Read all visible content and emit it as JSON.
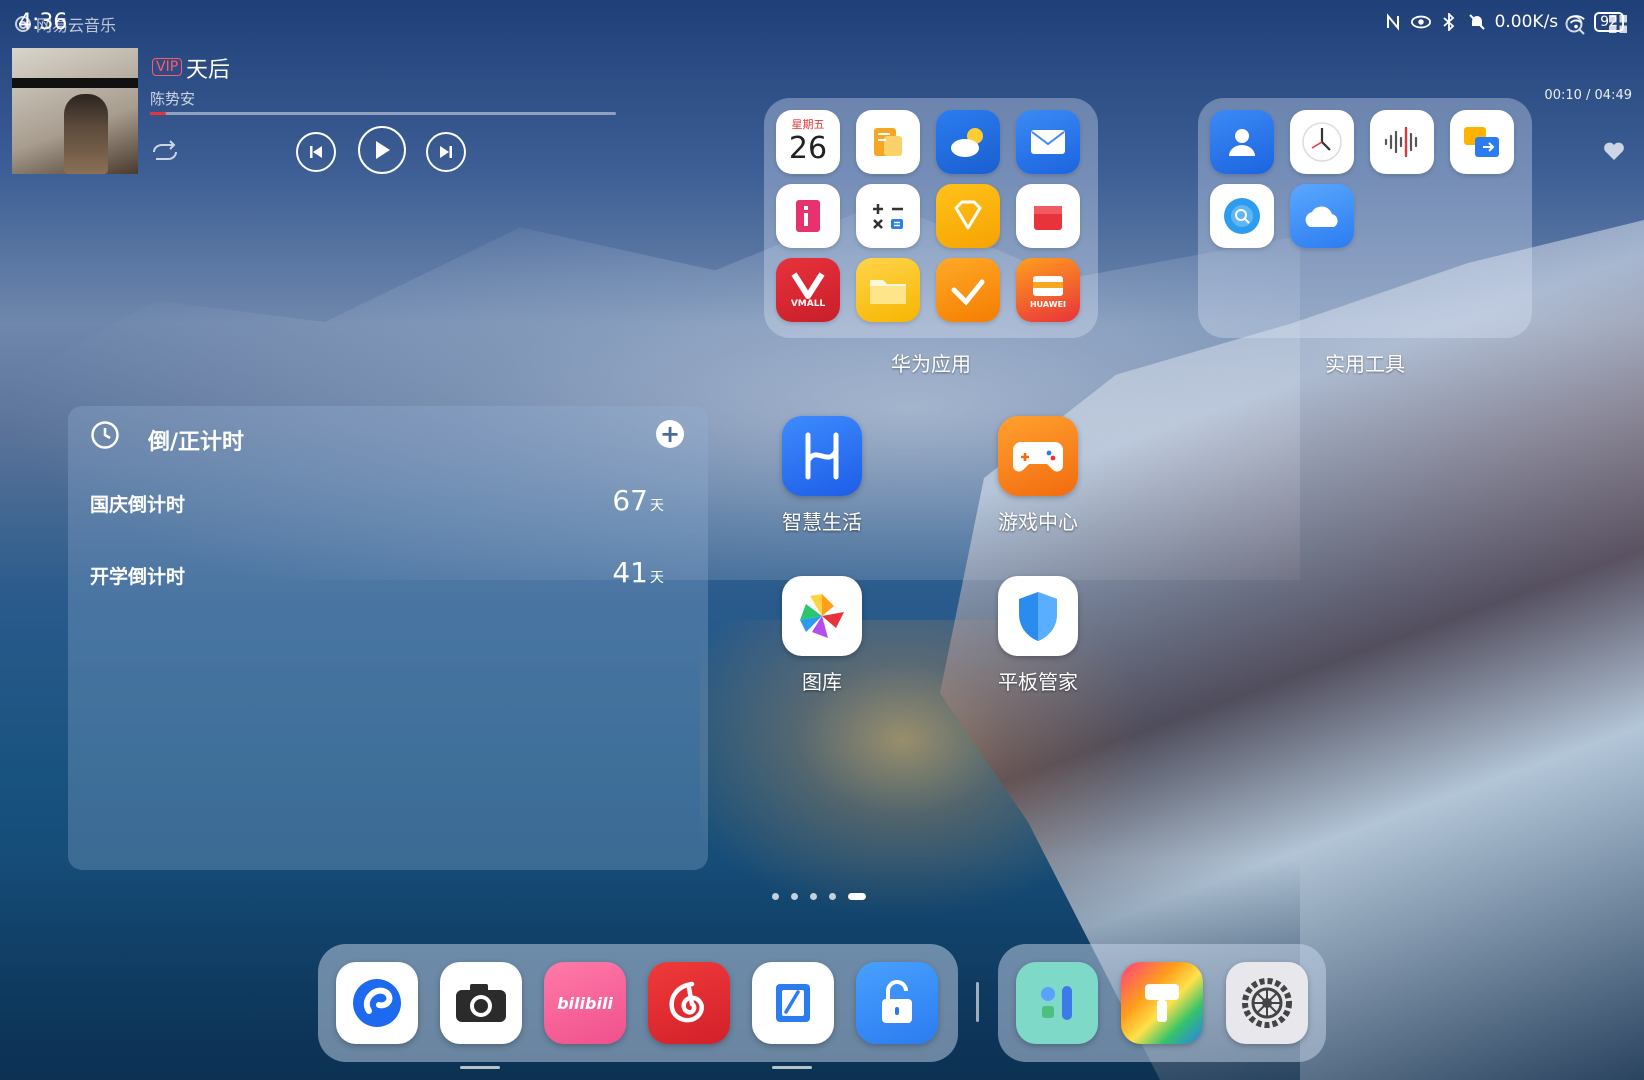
{
  "status_bar": {
    "time": "4:36",
    "net_speed": "0.00K/s",
    "battery": "92"
  },
  "music_widget": {
    "app_name": "网易云音乐",
    "badge": "VIP",
    "song": "天后",
    "artist": "陈势安",
    "time_display": "00:10 / 04:49",
    "progress": 0.035
  },
  "countdown_widget": {
    "title": "倒/正计时",
    "add_symbol": "+",
    "items": [
      {
        "name": "国庆倒计时",
        "value": "67",
        "unit": "天"
      },
      {
        "name": "开学倒计时",
        "value": "41",
        "unit": "天"
      }
    ]
  },
  "folders": {
    "huawei": {
      "label": "华为应用",
      "calendar_weekday": "星期五",
      "calendar_day": "26",
      "vmall_text": "VMALL",
      "huawei_text": "HUAWEI"
    },
    "tools": {
      "label": "实用工具"
    }
  },
  "apps": [
    {
      "label": "智慧生活"
    },
    {
      "label": "游戏中心"
    },
    {
      "label": "图库"
    },
    {
      "label": "平板管家"
    }
  ],
  "dock": {
    "bilibili_text": "bilibili"
  },
  "colors": {
    "accent_red": "#e8323c",
    "vip": "#ff5a6a"
  }
}
